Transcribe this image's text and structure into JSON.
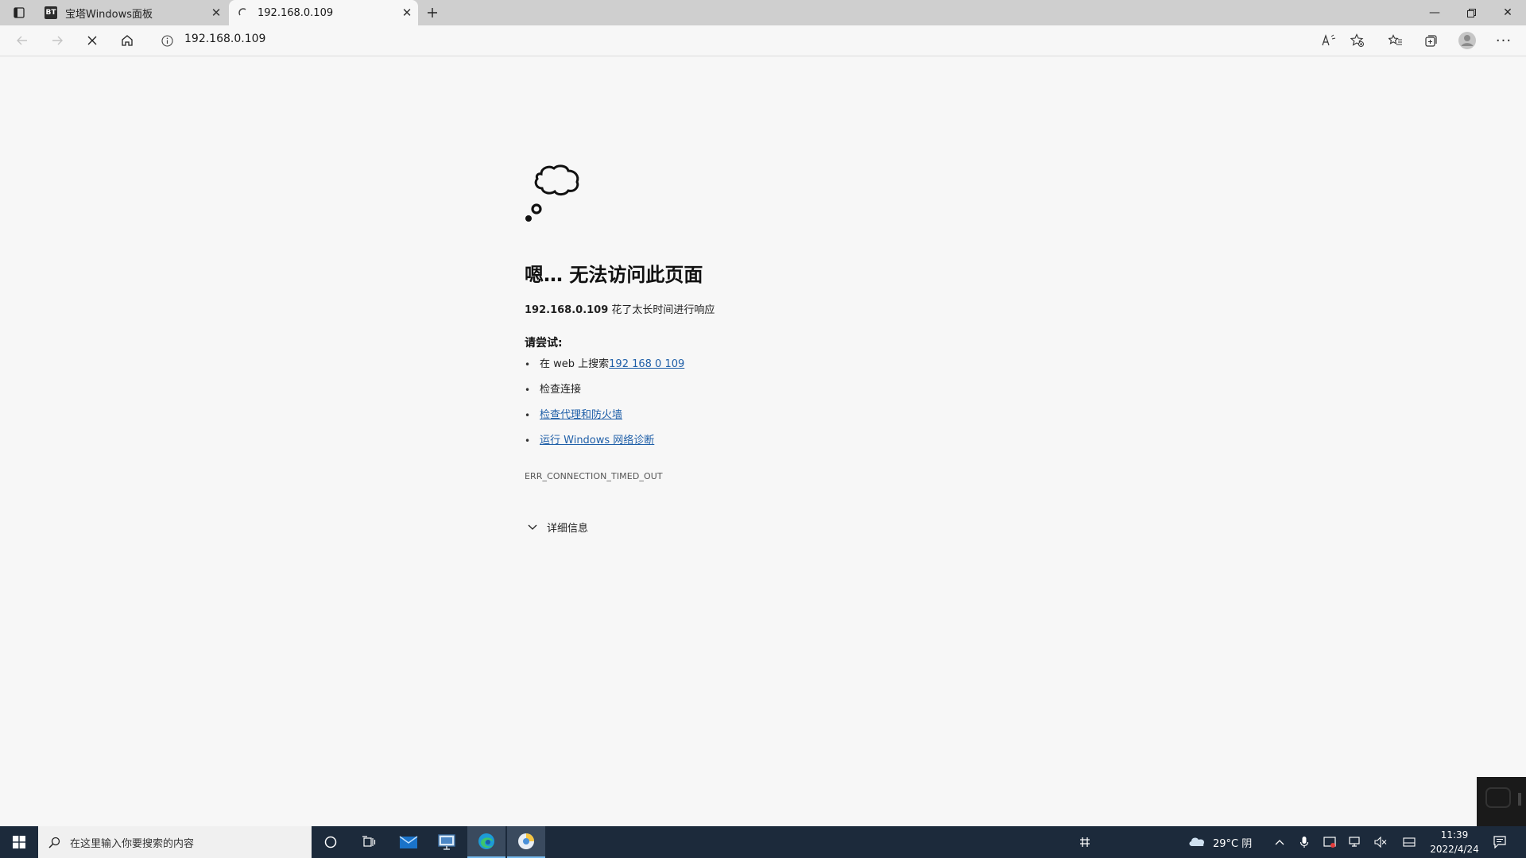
{
  "tabs": [
    {
      "title": "宝塔Windows面板",
      "favicon": "BT"
    },
    {
      "title": "192.168.0.109",
      "favicon": "loading-spinner"
    }
  ],
  "address": {
    "url": "192.168.0.109"
  },
  "error": {
    "heading": "嗯… 无法访问此页面",
    "host": "192.168.0.109",
    "message": " 花了太长时间进行响应",
    "try_label": "请尝试:",
    "suggestions": {
      "search_prefix": "在 web 上搜索 ",
      "search_link": "192 168 0 109",
      "check_connection": "检查连接",
      "check_proxy": "检查代理和防火墙",
      "run_diagnostics": "运行 Windows 网络诊断"
    },
    "code": "ERR_CONNECTION_TIMED_OUT",
    "details_label": "详细信息"
  },
  "taskbar": {
    "search_placeholder": "在这里输入你要搜索的内容",
    "weather": "29°C 阴",
    "time": "11:39",
    "date": "2022/4/24"
  },
  "colors": {
    "accent": "#1f5fa8",
    "taskbar": "#1c2a3b",
    "tabbar": "#cfcfcf"
  }
}
